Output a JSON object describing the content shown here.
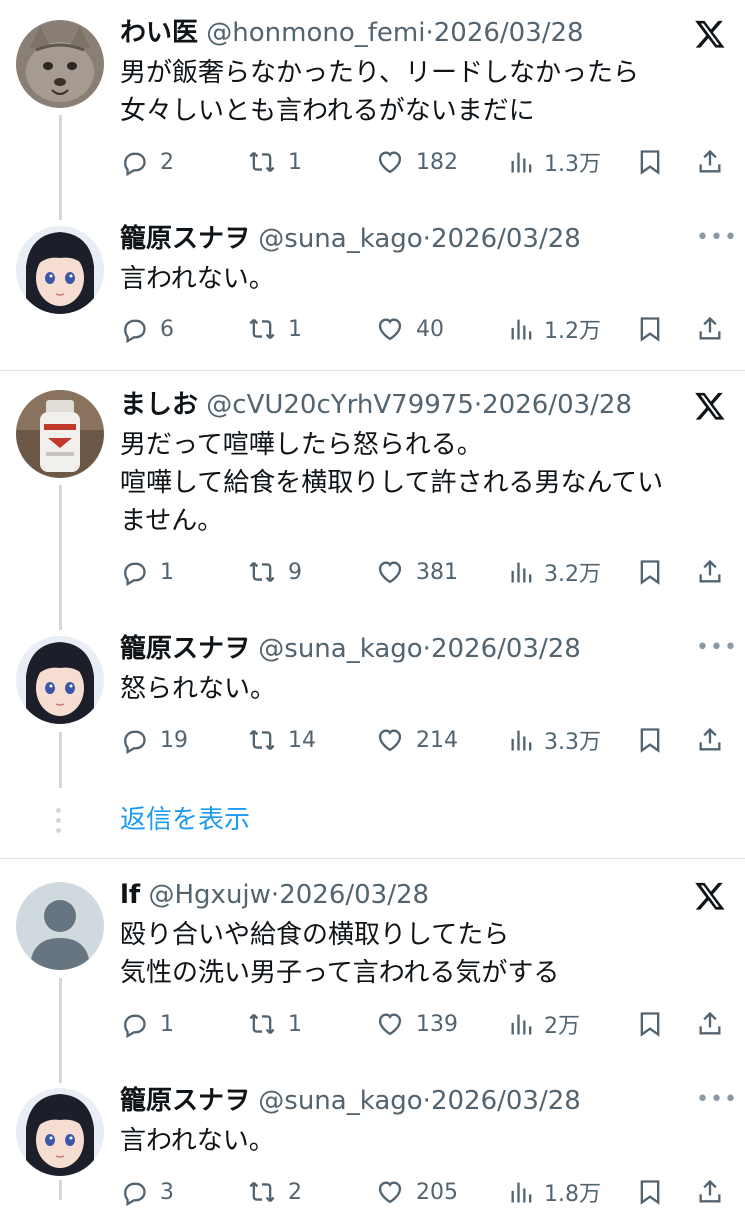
{
  "tweets": [
    {
      "name": "わい医",
      "handle": "@honmono_femi",
      "date": "2026/03/28",
      "text": "男が飯奢らなかったり、リードしなかったら\n女々しいとも言われるがないまだに",
      "reply": "2",
      "retweet": "1",
      "like": "182",
      "views": "1.3万",
      "avatar_icon": "cat-avatar-icon",
      "corner_icon": "x-logo-icon"
    },
    {
      "name": "籠原スナヲ",
      "handle": "@suna_kago",
      "date": "2026/03/28",
      "text": "言われない。",
      "reply": "6",
      "retweet": "1",
      "like": "40",
      "views": "1.2万",
      "avatar_icon": "anime-girl-avatar-icon",
      "corner_icon": "more-icon"
    },
    {
      "name": "ましお",
      "handle": "@cVU20cYrhV79975",
      "date": "2026/03/28",
      "text": "男だって喧嘩したら怒られる。\n喧嘩して給食を横取りして許される男なんてい\nません。",
      "reply": "1",
      "retweet": "9",
      "like": "381",
      "views": "3.2万",
      "avatar_icon": "salt-bottle-avatar-icon",
      "corner_icon": "x-logo-icon"
    },
    {
      "name": "籠原スナヲ",
      "handle": "@suna_kago",
      "date": "2026/03/28",
      "text": "怒られない。",
      "reply": "19",
      "retweet": "14",
      "like": "214",
      "views": "3.3万",
      "avatar_icon": "anime-girl-avatar-icon",
      "corner_icon": "more-icon"
    },
    {
      "name": "lf",
      "handle": "@Hgxujw",
      "date": "2026/03/28",
      "text": "殴り合いや給食の横取りしてたら\n気性の洗い男子って言われる気がする",
      "reply": "1",
      "retweet": "1",
      "like": "139",
      "views": "2万",
      "avatar_icon": "default-avatar-icon",
      "corner_icon": "x-logo-icon"
    },
    {
      "name": "籠原スナヲ",
      "handle": "@suna_kago",
      "date": "2026/03/28",
      "text": "言われない。",
      "reply": "3",
      "retweet": "2",
      "like": "205",
      "views": "1.8万",
      "avatar_icon": "anime-girl-avatar-icon",
      "corner_icon": "more-icon"
    }
  ],
  "show_replies_label": "返信を表示",
  "separator": "·",
  "colors": {
    "text": "#0f1419",
    "secondary": "#536471",
    "link": "#1d9bf0",
    "thread_line": "#cfd9de"
  }
}
